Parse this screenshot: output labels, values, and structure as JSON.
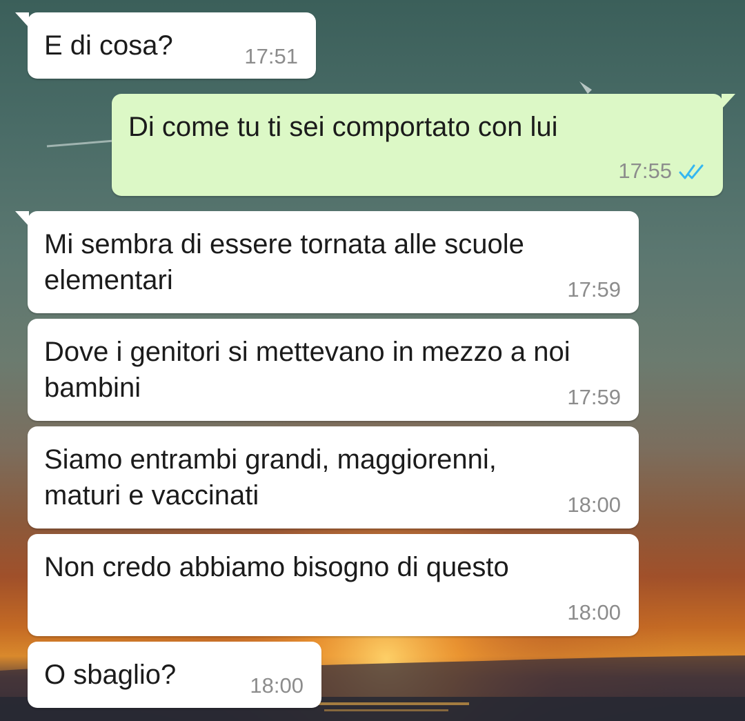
{
  "chat": {
    "messages": [
      {
        "direction": "in",
        "text": "E di cosa?",
        "time": "17:51"
      },
      {
        "direction": "out",
        "text": "Di come tu ti sei comportato con lui",
        "time": "17:55",
        "status": "read"
      },
      {
        "direction": "in",
        "text": "Mi sembra di essere tornata alle scuole\nelementari",
        "time": "17:59"
      },
      {
        "direction": "in",
        "text": "Dove i genitori si mettevano in mezzo a noi\nbambini",
        "time": "17:59"
      },
      {
        "direction": "in",
        "text": "Siamo entrambi grandi, maggiorenni,\nmaturi e vaccinati",
        "time": "18:00"
      },
      {
        "direction": "in",
        "text": "Non credo abbiamo bisogno di questo",
        "time": "18:00"
      },
      {
        "direction": "in",
        "text": "O sbaglio?",
        "time": "18:00"
      }
    ]
  },
  "icons": {
    "read_receipt": "double-check-icon"
  },
  "colors": {
    "incoming_bubble": "#ffffff",
    "outgoing_bubble": "#dcf8c6",
    "timestamp": "#8c8c8c",
    "read_ticks": "#34b7f1",
    "message_text": "#1b1b1b"
  }
}
